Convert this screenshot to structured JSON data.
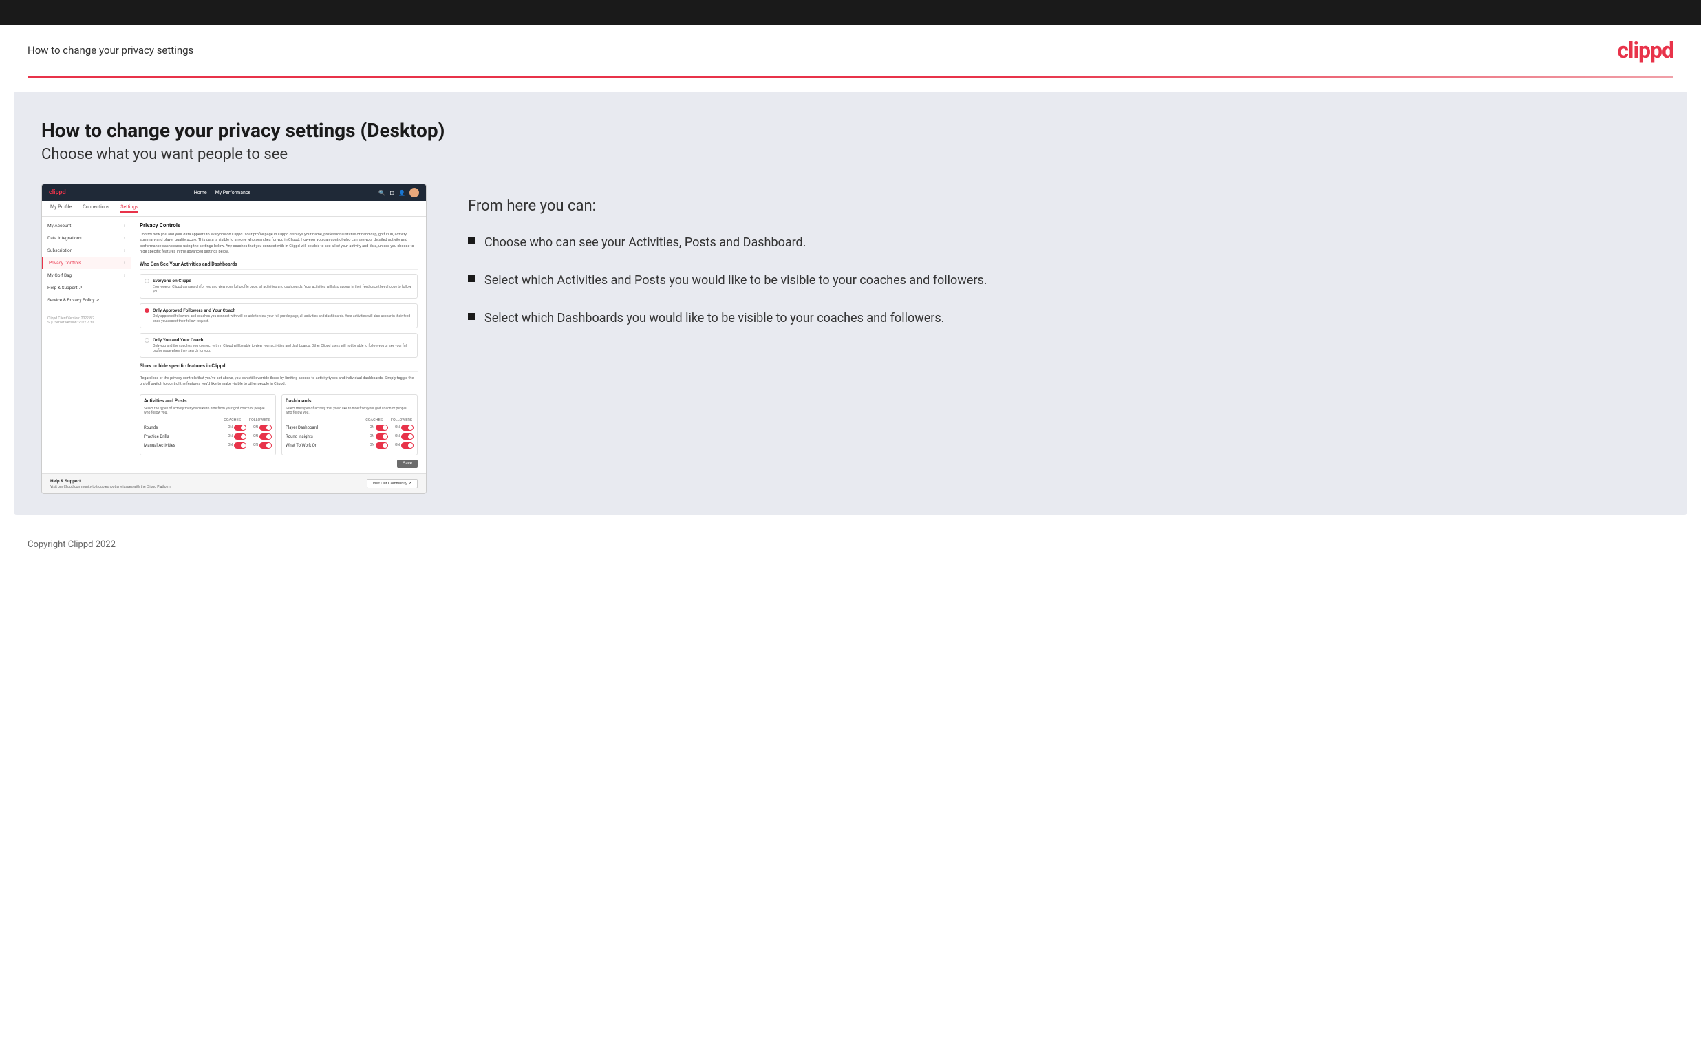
{
  "topBar": {},
  "header": {
    "title": "How to change your privacy settings",
    "logo": "clippd"
  },
  "main": {
    "pageTitle": "How to change your privacy settings (Desktop)",
    "pageSubtitle": "Choose what you want people to see",
    "rightPanel": {
      "fromHere": "From here you can:",
      "bullets": [
        "Choose who can see your Activities, Posts and Dashboard.",
        "Select which Activities and Posts you would like to be visible to your coaches and followers.",
        "Select which Dashboards you would like to be visible to your coaches and followers."
      ]
    },
    "screenshot": {
      "navLinks": [
        "Home",
        "My Performance"
      ],
      "tabs": [
        "My Profile",
        "Connections",
        "Settings"
      ],
      "activeTab": "Settings",
      "sidebar": {
        "items": [
          {
            "label": "My Account",
            "hasArrow": true
          },
          {
            "label": "Data Integrations",
            "hasArrow": true
          },
          {
            "label": "Subscription",
            "hasArrow": true
          },
          {
            "label": "Privacy Controls",
            "hasArrow": true,
            "active": true
          },
          {
            "label": "My Golf Bag",
            "hasArrow": true
          },
          {
            "label": "Help & Support ↗",
            "hasArrow": false
          },
          {
            "label": "Service & Privacy Policy ↗",
            "hasArrow": false
          }
        ],
        "version": "Clippd Client Version: 2022.8.2\nSQL Server Version: 2022.7.30"
      },
      "privacyControls": {
        "title": "Privacy Controls",
        "desc": "Control how you and your data appears to everyone on Clippd. Your profile page in Clippd displays your name, professional status or handicap, golf club, activity summary and player quality score. This data is visible to anyone who searches for you in Clippd. However you can control who can see your detailed activity and performance dashboards using the settings below. Any coaches that you connect with in Clippd will be able to see all of your activity and data, unless you choose to hide specific features in the advanced settings below.",
        "whoCanSeeTitle": "Who Can See Your Activities and Dashboards",
        "radioOptions": [
          {
            "label": "Everyone on Clippd",
            "desc": "Everyone on Clippd can search for you and view your full profile page, all activities and dashboards. Your activities will also appear in their feed once they choose to follow you.",
            "checked": false
          },
          {
            "label": "Only Approved Followers and Your Coach",
            "desc": "Only approved followers and coaches you connect with will be able to view your full profile page, all activities and dashboards. Your activities will also appear in their feed once you accept their follow request.",
            "checked": true
          },
          {
            "label": "Only You and Your Coach",
            "desc": "Only you and the coaches you connect with in Clippd will be able to view your activities and dashboards. Other Clippd users will not be able to follow you or see your full profile page when they search for you.",
            "checked": false
          }
        ],
        "showHideTitle": "Show or hide specific features in Clippd",
        "showHideDesc": "Regardless of the privacy controls that you've set above, you can still override these by limiting access to activity types and individual dashboards. Simply toggle the on/off switch to control the features you'd like to make visible to other people in Clippd.",
        "activitiesPosts": {
          "title": "Activities and Posts",
          "desc": "Select the types of activity that you'd like to hide from your golf coach or people who follow you.",
          "items": [
            "Rounds",
            "Practice Drills",
            "Manual Activities"
          ]
        },
        "dashboards": {
          "title": "Dashboards",
          "desc": "Select the types of activity that you'd like to hide from your golf coach or people who follow you.",
          "items": [
            "Player Dashboard",
            "Round Insights",
            "What To Work On"
          ]
        },
        "saveLabel": "Save",
        "helpSection": {
          "title": "Help & Support",
          "desc": "Visit our Clippd community to troubleshoot any issues with the Clippd Platform.",
          "buttonLabel": "Visit Our Community ↗"
        }
      }
    }
  },
  "footer": {
    "copyright": "Copyright Clippd 2022"
  }
}
